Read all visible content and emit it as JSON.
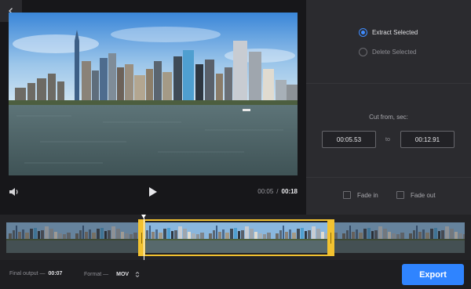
{
  "player": {
    "current_time": "00:05",
    "time_separator": "/",
    "duration": "00:18"
  },
  "options": {
    "mode": [
      {
        "label": "Extract Selected",
        "checked": true
      },
      {
        "label": "Delete Selected",
        "checked": false
      }
    ],
    "cut_label": "Cut from, sec:",
    "from_time": "00:05.53",
    "to_label": "to",
    "to_time": "00:12.91",
    "fade_in_label": "Fade in",
    "fade_out_label": "Fade out",
    "fade_in_checked": false,
    "fade_out_checked": false
  },
  "timeline": {
    "selection_start": "00:05.53",
    "selection_end": "00:12.91",
    "frame_count": 7
  },
  "footer": {
    "final_output_label": "Final output —",
    "final_output_value": "00:07",
    "format_label": "Format —",
    "format_value": "MOV",
    "export_label": "Export"
  },
  "colors": {
    "accent": "#2f84ff",
    "selection": "#f2c230",
    "panel_dark": "#17171a",
    "panel": "#2b2b2f"
  },
  "icons": [
    "back-arrow-icon",
    "volume-icon",
    "play-icon",
    "format-chevron-icon"
  ]
}
